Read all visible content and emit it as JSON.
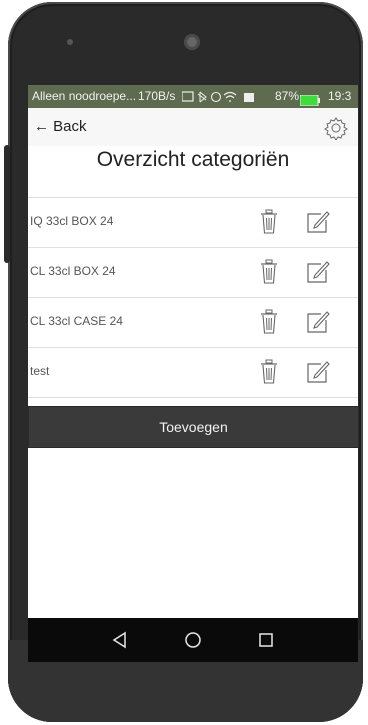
{
  "status_bar": {
    "carrier": "Alleen noodroepe...",
    "speed": "170B/s",
    "battery": "87%",
    "time": "19:3",
    "icons": [
      "sim-icon",
      "bluetooth-icon",
      "alarm-icon",
      "wifi-icon",
      "signal-icon",
      "battery-icon"
    ]
  },
  "header": {
    "back_label": "← Back",
    "settings_icon": "gear-icon"
  },
  "page": {
    "title": "Overzicht categoriën"
  },
  "categories": [
    {
      "label": "IQ 33cl BOX 24"
    },
    {
      "label": "CL 33cl BOX 24"
    },
    {
      "label": "CL 33cl CASE 24"
    },
    {
      "label": "test"
    }
  ],
  "actions": {
    "add_label": "Toevoegen"
  },
  "nav": {
    "icons": [
      "back-triangle-icon",
      "home-circle-icon",
      "recents-square-icon"
    ]
  },
  "colors": {
    "status_bar": "#5f6b4f",
    "button": "#3a3a3a",
    "nav_bar": "#0a0a0a"
  }
}
